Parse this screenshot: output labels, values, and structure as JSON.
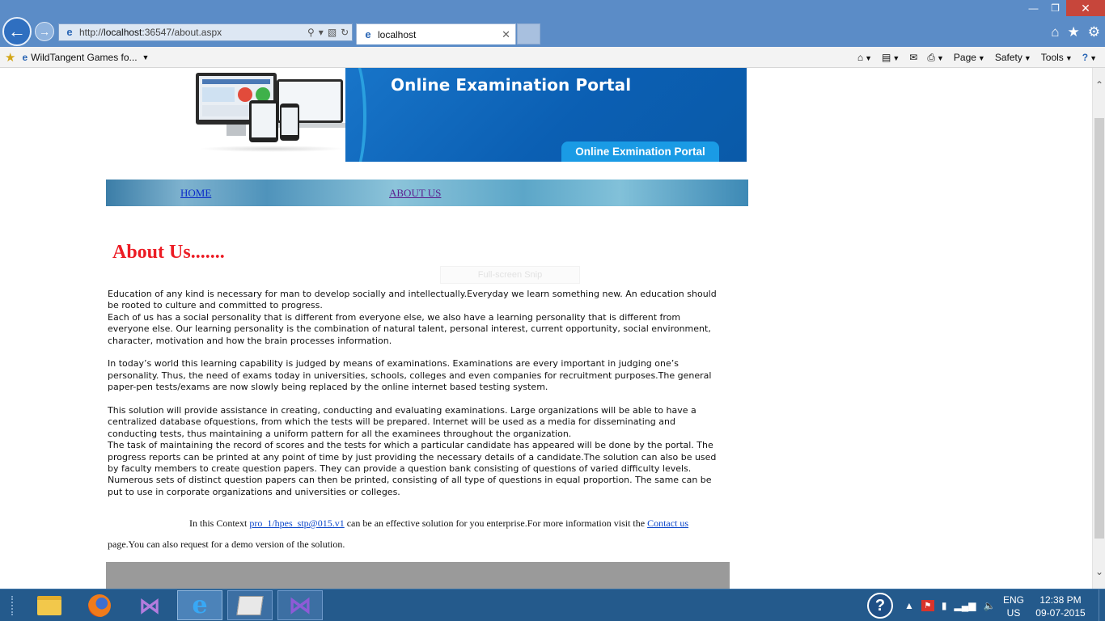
{
  "browser": {
    "url_prefix": "http://",
    "url_host": "localhost",
    "url_rest": ":36547/about.aspx",
    "tab_title": "localhost",
    "favorites_item": "WildTangent Games fo...",
    "commands": {
      "page": "Page",
      "safety": "Safety",
      "tools": "Tools"
    },
    "icons": [
      "back-arrow-icon",
      "forward-arrow-icon",
      "search-icon",
      "compat-icon",
      "refresh-icon",
      "home-icon",
      "star-icon",
      "gear-icon",
      "rss-icon",
      "mail-icon",
      "print-icon",
      "help-icon"
    ]
  },
  "page": {
    "banner_title": "Online Examination Portal",
    "banner_tag": "Online Exmination Portal",
    "menu": {
      "home": "HOME",
      "about": "ABOUT US"
    },
    "heading": "About Us.......",
    "snip_overlay": "Full-screen Snip",
    "paragraphs": [
      "Education of any kind is necessary for man to develop socially and intellectually.Everyday we learn something new. An education should be rooted to culture and committed to progress.",
      "Each of us has a social personality that is different from everyone else, we also have a learning personality that is different from everyone else. Our learning personality is the combination of natural talent, personal interest, current opportunity, social environment, character, motivation and how the brain processes information.",
      "In today’s world this learning capability is judged by means of examinations. Examinations are every important in judging one’s personality. Thus, the need of exams today in universities, schools, colleges and even companies for recruitment purposes.The general paper-pen tests/exams are now slowly being replaced by the online internet based testing system.",
      "This solution will provide assistance in creating, conducting and evaluating examinations. Large organizations will be able to have a centralized database ofquestions, from which the tests will be prepared. Internet will be used as a media for disseminating and conducting tests, thus maintaining a uniform pattern for all the examinees throughout the organization.",
      "The task of maintaining the record of scores and the tests for which a particular candidate has appeared will be done by the portal. The progress reports can be printed at any point of time by just providing the necessary details of a candidate.The solution can also be used by faculty members to create question papers. They can provide a question bank consisting of questions of varied difficulty levels. Numerous sets of distinct question papers can then be printed, consisting of all type of questions in equal proportion. The same can be put to use in corporate organizations and universities or colleges."
    ],
    "context": {
      "prefix": "In this Context ",
      "product_link": "pro_1/hpes_stp@015.v1",
      "middle": " can be an effective solution for you enterprise.For more information  visit the ",
      "contact_link": "Contact us",
      "tail": "page.You can also request for a demo version of the solution."
    }
  },
  "taskbar": {
    "apps": [
      "file-explorer",
      "firefox",
      "visual-studio",
      "internet-explorer",
      "snipping-tool",
      "visual-studio-2013"
    ],
    "active_app": "internet-explorer",
    "lang_line1": "ENG",
    "lang_line2": "US",
    "time": "12:38 PM",
    "date": "09-07-2015"
  }
}
